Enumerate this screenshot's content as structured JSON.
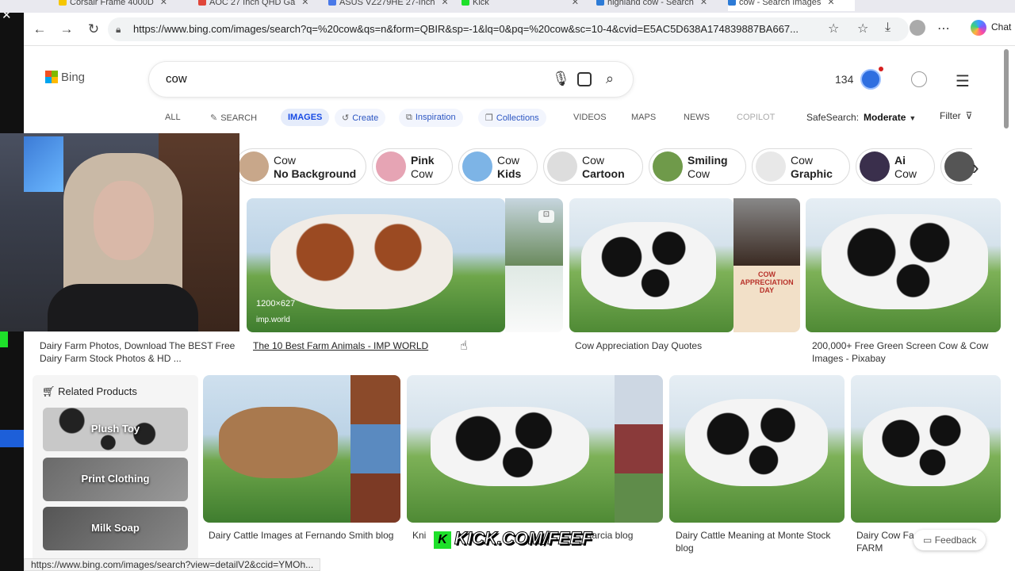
{
  "browser": {
    "tabs": [
      {
        "label": "Corsair Frame 4000D",
        "color": "#f5c600"
      },
      {
        "label": "AOC 27 Inch QHD Ga",
        "color": "#e0463a"
      },
      {
        "label": "ASUS VZ279HE 27-Inch",
        "color": "#4a79e8"
      },
      {
        "label": "Kick",
        "color": "#1ee02a"
      },
      {
        "label": "highland cow - Search",
        "color": "#2d7bd6"
      },
      {
        "label": "cow - Search Images",
        "color": "#2d7bd6"
      }
    ],
    "url": "https://www.bing.com/images/search?q=%20cow&qs=n&form=QBIR&sp=-1&lq=0&pq=%20cow&sc=10-4&cvid=E5AC5D638A174839887BA667...",
    "chat_label": "Chat",
    "status_url": "https://www.bing.com/images/search?view=detailV2&ccid=YMOh..."
  },
  "bing": {
    "logo_text": "Bing",
    "query": "cow",
    "points": "134",
    "scopes": [
      {
        "label": "ALL"
      },
      {
        "label": "SEARCH"
      },
      {
        "label": "IMAGES"
      },
      {
        "label": "Create"
      },
      {
        "label": "Inspiration"
      },
      {
        "label": "Collections"
      },
      {
        "label": "VIDEOS"
      },
      {
        "label": "MAPS"
      },
      {
        "label": "NEWS"
      },
      {
        "label": "COPILOT"
      }
    ],
    "safesearch_label": "SafeSearch:",
    "safesearch_value": "Moderate",
    "filter_label": "Filter"
  },
  "chips": [
    {
      "line1": "Cow",
      "line2": "No Background"
    },
    {
      "line1": "Pink",
      "line2": "Cow"
    },
    {
      "line1": "Cow",
      "line2": "Kids"
    },
    {
      "line1": "Cow",
      "line2": "Cartoon"
    },
    {
      "line1": "Smiling",
      "line2": "Cow"
    },
    {
      "line1": "Cow",
      "line2": "Graphic"
    },
    {
      "line1": "Ai",
      "line2": "Cow"
    }
  ],
  "results_row1": [
    {
      "caption": "Dairy Farm Photos, Download The BEST Free Dairy Farm Stock Photos & HD ..."
    },
    {
      "caption": "The 10 Best Farm Animals - IMP WORLD",
      "size": "1200×627",
      "source": "imp.world"
    },
    {
      "caption": "Cow Appreciation Day Quotes",
      "overlay": "COW APPRECIATION DAY"
    },
    {
      "caption": "200,000+ Free Green Screen Cow & Cow Images - Pixabay"
    }
  ],
  "related": {
    "title": "Related Products",
    "items": [
      "Plush Toy",
      "Print Clothing",
      "Milk Soap"
    ]
  },
  "results_row2": [
    {
      "caption": "Dairy Cattle Images at Fernando Smith blog"
    },
    {
      "caption": "Kni",
      "caption_end": "Garcia blog"
    },
    {
      "caption": "Dairy Cattle Meaning at Monte Stock blog"
    },
    {
      "caption": "Dairy Cow Fa",
      "caption2": "FARM"
    }
  ],
  "overlays": {
    "kick_text": "KICK.COM/FEEF",
    "feedback": "Feedback"
  }
}
